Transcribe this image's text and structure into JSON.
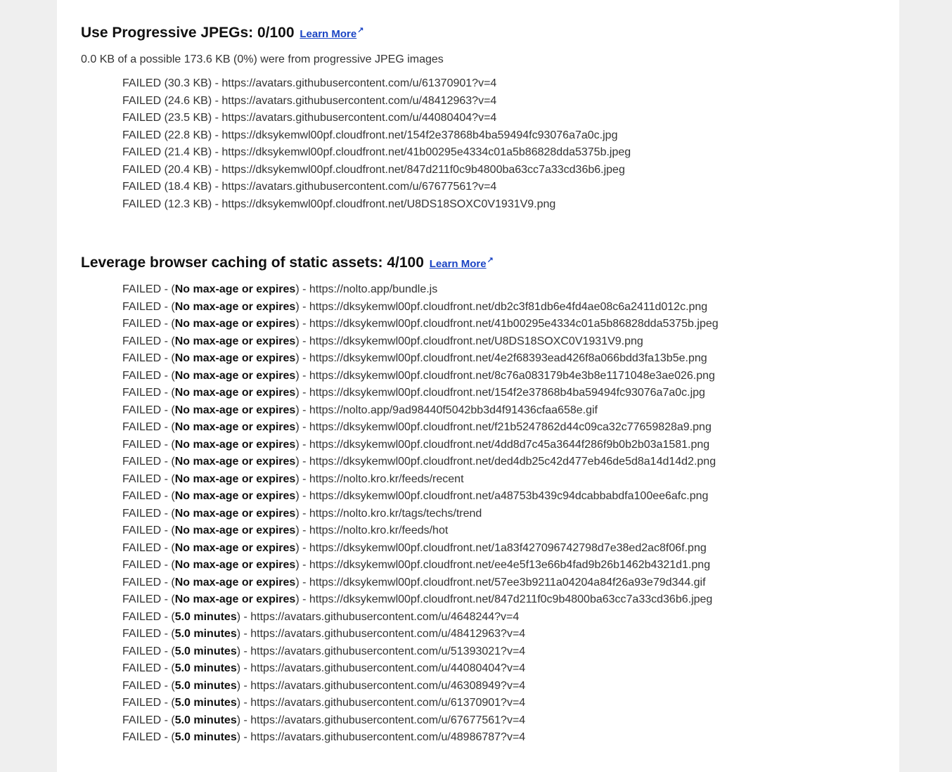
{
  "sections": [
    {
      "title": "Use Progressive JPEGs: 0/100",
      "learn_more": "Learn More",
      "ext_icon": "external-link-icon",
      "summary": "0.0 KB of a possible 173.6 KB (0%) were from progressive JPEG images",
      "items": [
        "FAILED (30.3 KB) - https://avatars.githubusercontent.com/u/61370901?v=4",
        "FAILED (24.6 KB) - https://avatars.githubusercontent.com/u/48412963?v=4",
        "FAILED (23.5 KB) - https://avatars.githubusercontent.com/u/44080404?v=4",
        "FAILED (22.8 KB) - https://dksykemwl00pf.cloudfront.net/154f2e37868b4ba59494fc93076a7a0c.jpg",
        "FAILED (21.4 KB) - https://dksykemwl00pf.cloudfront.net/41b00295e4334c01a5b86828dda5375b.jpeg",
        "FAILED (20.4 KB) - https://dksykemwl00pf.cloudfront.net/847d211f0c9b4800ba63cc7a33cd36b6.jpeg",
        "FAILED (18.4 KB) - https://avatars.githubusercontent.com/u/67677561?v=4",
        "FAILED (12.3 KB) - https://dksykemwl00pf.cloudfront.net/U8DS18SOXC0V1931V9.png"
      ]
    },
    {
      "title": "Leverage browser caching of static assets: 4/100",
      "learn_more": "Learn More",
      "ext_icon": "external-link-icon",
      "items": [
        {
          "prefix": "FAILED - (",
          "bold": "No max-age or expires",
          "suffix": ") - https://nolto.app/bundle.js"
        },
        {
          "prefix": "FAILED - (",
          "bold": "No max-age or expires",
          "suffix": ") - https://dksykemwl00pf.cloudfront.net/db2c3f81db6e4fd4ae08c6a2411d012c.png"
        },
        {
          "prefix": "FAILED - (",
          "bold": "No max-age or expires",
          "suffix": ") - https://dksykemwl00pf.cloudfront.net/41b00295e4334c01a5b86828dda5375b.jpeg"
        },
        {
          "prefix": "FAILED - (",
          "bold": "No max-age or expires",
          "suffix": ") - https://dksykemwl00pf.cloudfront.net/U8DS18SOXC0V1931V9.png"
        },
        {
          "prefix": "FAILED - (",
          "bold": "No max-age or expires",
          "suffix": ") - https://dksykemwl00pf.cloudfront.net/4e2f68393ead426f8a066bdd3fa13b5e.png"
        },
        {
          "prefix": "FAILED - (",
          "bold": "No max-age or expires",
          "suffix": ") - https://dksykemwl00pf.cloudfront.net/8c76a083179b4e3b8e1171048e3ae026.png"
        },
        {
          "prefix": "FAILED - (",
          "bold": "No max-age or expires",
          "suffix": ") - https://dksykemwl00pf.cloudfront.net/154f2e37868b4ba59494fc93076a7a0c.jpg"
        },
        {
          "prefix": "FAILED - (",
          "bold": "No max-age or expires",
          "suffix": ") - https://nolto.app/9ad98440f5042bb3d4f91436cfaa658e.gif"
        },
        {
          "prefix": "FAILED - (",
          "bold": "No max-age or expires",
          "suffix": ") - https://dksykemwl00pf.cloudfront.net/f21b5247862d44c09ca32c77659828a9.png"
        },
        {
          "prefix": "FAILED - (",
          "bold": "No max-age or expires",
          "suffix": ") - https://dksykemwl00pf.cloudfront.net/4dd8d7c45a3644f286f9b0b2b03a1581.png"
        },
        {
          "prefix": "FAILED - (",
          "bold": "No max-age or expires",
          "suffix": ") - https://dksykemwl00pf.cloudfront.net/ded4db25c42d477eb46de5d8a14d14d2.png"
        },
        {
          "prefix": "FAILED - (",
          "bold": "No max-age or expires",
          "suffix": ") - https://nolto.kro.kr/feeds/recent"
        },
        {
          "prefix": "FAILED - (",
          "bold": "No max-age or expires",
          "suffix": ") - https://dksykemwl00pf.cloudfront.net/a48753b439c94dcabbabdfa100ee6afc.png"
        },
        {
          "prefix": "FAILED - (",
          "bold": "No max-age or expires",
          "suffix": ") - https://nolto.kro.kr/tags/techs/trend"
        },
        {
          "prefix": "FAILED - (",
          "bold": "No max-age or expires",
          "suffix": ") - https://nolto.kro.kr/feeds/hot"
        },
        {
          "prefix": "FAILED - (",
          "bold": "No max-age or expires",
          "suffix": ") - https://dksykemwl00pf.cloudfront.net/1a83f427096742798d7e38ed2ac8f06f.png"
        },
        {
          "prefix": "FAILED - (",
          "bold": "No max-age or expires",
          "suffix": ") - https://dksykemwl00pf.cloudfront.net/ee4e5f13e66b4fad9b26b1462b4321d1.png"
        },
        {
          "prefix": "FAILED - (",
          "bold": "No max-age or expires",
          "suffix": ") - https://dksykemwl00pf.cloudfront.net/57ee3b9211a04204a84f26a93e79d344.gif"
        },
        {
          "prefix": "FAILED - (",
          "bold": "No max-age or expires",
          "suffix": ") - https://dksykemwl00pf.cloudfront.net/847d211f0c9b4800ba63cc7a33cd36b6.jpeg"
        },
        {
          "prefix": "FAILED - (",
          "bold": "5.0 minutes",
          "suffix": ") - https://avatars.githubusercontent.com/u/4648244?v=4"
        },
        {
          "prefix": "FAILED - (",
          "bold": "5.0 minutes",
          "suffix": ") - https://avatars.githubusercontent.com/u/48412963?v=4"
        },
        {
          "prefix": "FAILED - (",
          "bold": "5.0 minutes",
          "suffix": ") - https://avatars.githubusercontent.com/u/51393021?v=4"
        },
        {
          "prefix": "FAILED - (",
          "bold": "5.0 minutes",
          "suffix": ") - https://avatars.githubusercontent.com/u/44080404?v=4"
        },
        {
          "prefix": "FAILED - (",
          "bold": "5.0 minutes",
          "suffix": ") - https://avatars.githubusercontent.com/u/46308949?v=4"
        },
        {
          "prefix": "FAILED - (",
          "bold": "5.0 minutes",
          "suffix": ") - https://avatars.githubusercontent.com/u/61370901?v=4"
        },
        {
          "prefix": "FAILED - (",
          "bold": "5.0 minutes",
          "suffix": ") - https://avatars.githubusercontent.com/u/67677561?v=4"
        },
        {
          "prefix": "FAILED - (",
          "bold": "5.0 minutes",
          "suffix": ") - https://avatars.githubusercontent.com/u/48986787?v=4"
        }
      ]
    }
  ],
  "colors": {
    "page_background": "#efefef",
    "card_background": "#ffffff",
    "link": "#1a44c4",
    "text": "#333333"
  }
}
